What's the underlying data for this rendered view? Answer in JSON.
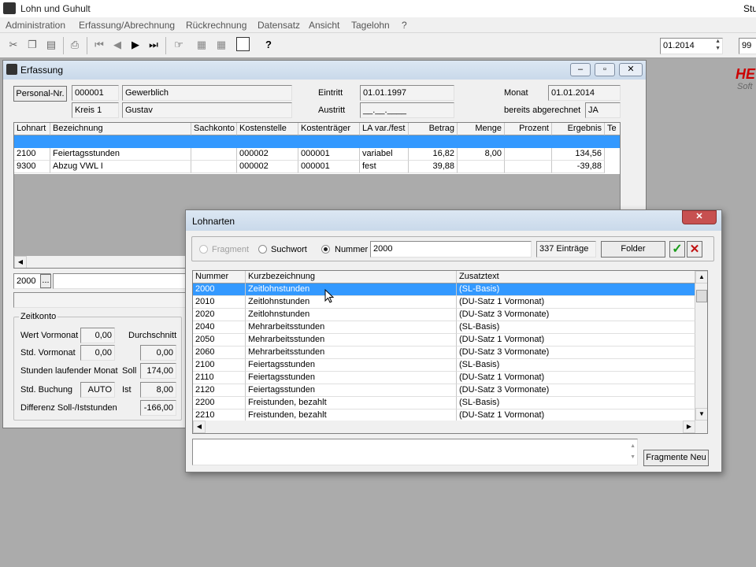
{
  "app": {
    "title": "Lohn und Guhult",
    "right_title": "Stu"
  },
  "menu": [
    "Administration",
    "Erfassung/Abrechnung",
    "Rückrechnung",
    "Datensatz",
    "Ansicht",
    "Tagelohn",
    "?"
  ],
  "toolbar": {
    "period": "01.2014",
    "num": "99"
  },
  "logo": {
    "main": "HE",
    "sub": "Soft"
  },
  "erfassung": {
    "title": "Erfassung",
    "personal_btn": "Personal-Nr.",
    "personal_nr": "000001",
    "kreis": "Kreis 1",
    "type": "Gewerblich",
    "name": "Gustav",
    "eintritt_label": "Eintritt",
    "eintritt": "01.01.1997",
    "austritt_label": "Austritt",
    "austritt": "__.__.____",
    "monat_label": "Monat",
    "monat": "01.01.2014",
    "abgerechnet_label": "bereits abgerechnet",
    "abgerechnet": "JA",
    "columns": [
      "Lohnart",
      "Bezeichnung",
      "Sachkonto",
      "Kostenstelle",
      "Kostenträger",
      "LA var./fest",
      "Betrag",
      "Menge",
      "Prozent",
      "Ergebnis",
      "Te"
    ],
    "rows": [
      [
        "",
        "",
        "",
        "",
        "",
        "",
        "",
        "",
        "",
        "",
        ""
      ],
      [
        "2100",
        "Feiertagsstunden",
        "",
        "000002",
        "000001",
        "variabel",
        "16,82",
        "8,00",
        "",
        "134,56",
        ""
      ],
      [
        "9300",
        "Abzug VWL I",
        "",
        "000002",
        "000001",
        "fest",
        "39,88",
        "",
        "",
        "-39,88",
        ""
      ]
    ],
    "input_value": "2000",
    "input_btn": "...",
    "zeitkonto": {
      "title": "Zeitkonto",
      "wert_label": "Wert Vormonat",
      "wert": "0,00",
      "durchschnitt_label": "Durchschnitt",
      "std_vormonat_label": "Std. Vormonat",
      "std_vormonat": "0,00",
      "durchschnitt": "0,00",
      "stunden_label": "Stunden laufender Monat",
      "soll_label": "Soll",
      "soll": "174,00",
      "buchung_label": "Std. Buchung",
      "buchung": "AUTO",
      "ist_label": "Ist",
      "ist": "8,00",
      "diff_label": "Differenz Soll-/Iststunden",
      "diff": "-166,00"
    }
  },
  "lohnarten": {
    "title": "Lohnarten",
    "radio_fragment": "Fragment",
    "radio_suchwort": "Suchwort",
    "radio_nummer": "Nummer",
    "search_value": "2000",
    "count": "337 Einträge",
    "folder_btn": "Folder",
    "new_fragments_btn": "Fragmente Neu",
    "columns": [
      "Nummer",
      "Kurzbezeichnung",
      "Zusatztext"
    ],
    "rows": [
      [
        "2000",
        "Zeitlohnstunden",
        "(SL-Basis)"
      ],
      [
        "2010",
        "Zeitlohnstunden",
        "(DU-Satz 1 Vormonat)"
      ],
      [
        "2020",
        "Zeitlohnstunden",
        "(DU-Satz 3 Vormonate)"
      ],
      [
        "2040",
        "Mehrarbeitsstunden",
        "(SL-Basis)"
      ],
      [
        "2050",
        "Mehrarbeitsstunden",
        "(DU-Satz 1 Vormonat)"
      ],
      [
        "2060",
        "Mehrarbeitsstunden",
        "(DU-Satz 3 Vormonate)"
      ],
      [
        "2100",
        "Feiertagsstunden",
        "(SL-Basis)"
      ],
      [
        "2110",
        "Feiertagsstunden",
        "(DU-Satz 1 Vormonat)"
      ],
      [
        "2120",
        "Feiertagsstunden",
        "(DU-Satz 3 Vormonate)"
      ],
      [
        "2200",
        "Freistunden, bezahlt",
        "(SL-Basis)"
      ],
      [
        "2210",
        "Freistunden, bezahlt",
        "(DU-Satz 1 Vormonat)"
      ]
    ]
  }
}
